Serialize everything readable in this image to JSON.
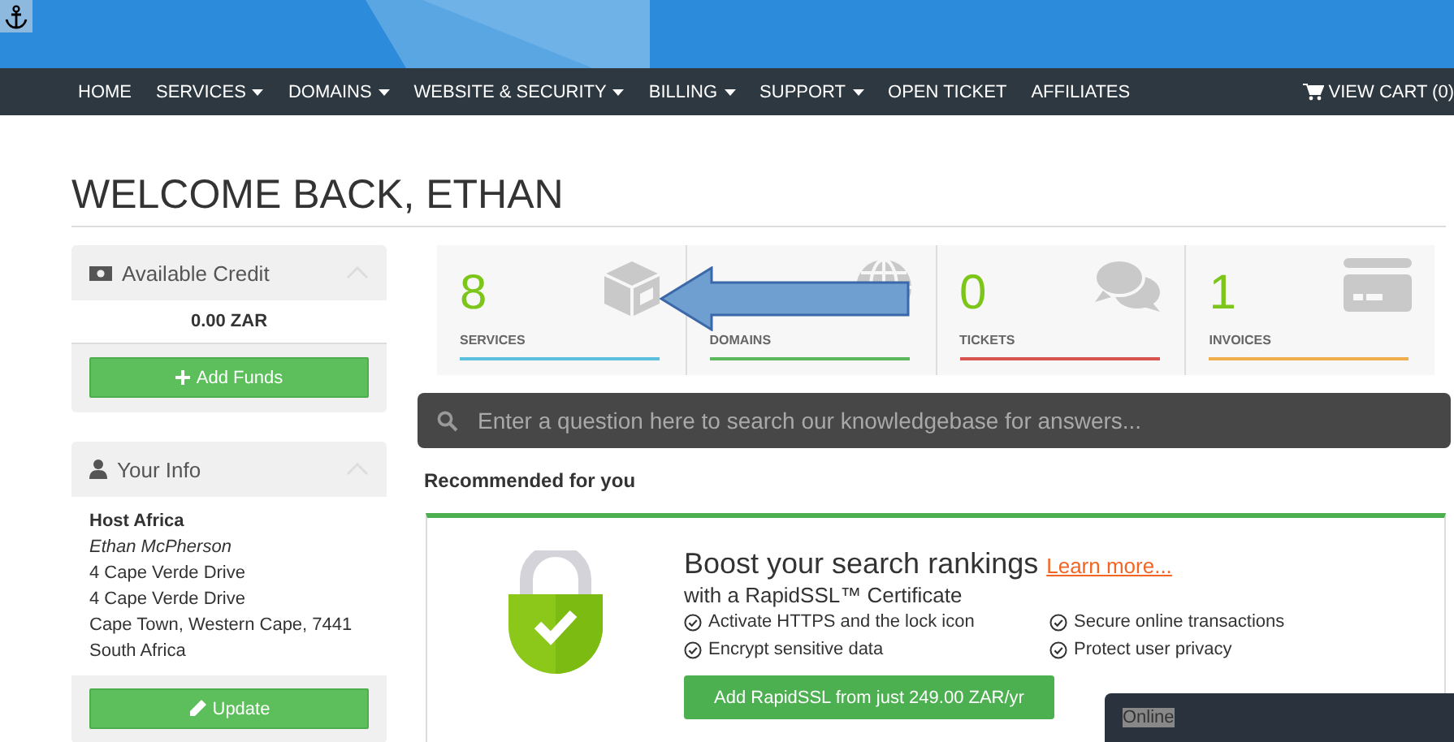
{
  "nav": {
    "items": [
      {
        "label": "HOME",
        "dropdown": false
      },
      {
        "label": "SERVICES",
        "dropdown": true
      },
      {
        "label": "DOMAINS",
        "dropdown": true
      },
      {
        "label": "WEBSITE & SECURITY",
        "dropdown": true
      },
      {
        "label": "BILLING",
        "dropdown": true
      },
      {
        "label": "SUPPORT",
        "dropdown": true
      },
      {
        "label": "OPEN TICKET",
        "dropdown": false
      },
      {
        "label": "AFFILIATES",
        "dropdown": false
      }
    ],
    "cart": "VIEW CART (0)"
  },
  "page_title": "WELCOME BACK, ETHAN",
  "credit_panel": {
    "title": "Available Credit",
    "amount": "0.00 ZAR",
    "button": "Add Funds"
  },
  "info_panel": {
    "title": "Your Info",
    "company": "Host Africa",
    "name": "Ethan McPherson",
    "lines": [
      "4 Cape Verde Drive",
      "4 Cape Verde Drive",
      "Cape Town, Western Cape, 7441",
      "South Africa"
    ],
    "button": "Update"
  },
  "stats": [
    {
      "kind": "box",
      "count": "8",
      "label": "SERVICES",
      "color": "#5bc0de"
    },
    {
      "kind": "globe",
      "label": "DOMAINS",
      "color": "#5cb85c"
    },
    {
      "kind": "chat",
      "count": "0",
      "label": "TICKETS",
      "color": "#d9534f"
    },
    {
      "kind": "card",
      "count": "1",
      "label": "INVOICES",
      "color": "#f0ad4e"
    }
  ],
  "search": {
    "placeholder": "Enter a question here to search our knowledgebase for answers..."
  },
  "recommended": {
    "heading": "Recommended for you",
    "headline": "Boost your search rankings",
    "link": "Learn more...",
    "subheading": "with a RapidSSL™ Certificate",
    "features": [
      "Activate HTTPS and the lock icon",
      "Secure online transactions",
      "Encrypt sensitive data",
      "Protect user privacy"
    ],
    "button": "Add RapidSSL from just 249.00 ZAR/yr"
  },
  "chat": {
    "status": "Online"
  }
}
